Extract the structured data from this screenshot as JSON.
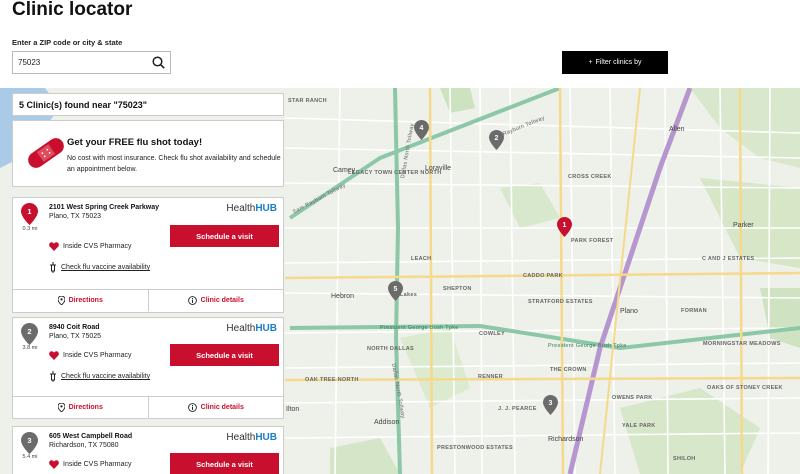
{
  "page": {
    "title": "Clinic locator"
  },
  "search": {
    "label": "Enter a ZIP code or city & state",
    "value": "75023",
    "placeholder": ""
  },
  "filter": {
    "label": "Filter clinics by"
  },
  "results": {
    "header": "5 Clinic(s) found near \"75023\""
  },
  "promo": {
    "title": "Get your FREE flu shot today!",
    "text": "No cost with most insurance. Check flu shot availability and schedule an appointment below."
  },
  "clinics": [
    {
      "number": "1",
      "distance": "0.3 mi",
      "street": "2101 West Spring Creek Parkway",
      "city": "Plano, TX 75023",
      "brand_a": "Health",
      "brand_b": "HUB",
      "schedule": "Schedule a visit",
      "inside": "Inside CVS Pharmacy",
      "flu": "Check flu vaccine availability",
      "directions": "Directions",
      "details": "Clinic details"
    },
    {
      "number": "2",
      "distance": "3.8 mi",
      "street": "8940 Coit Road",
      "city": "Plano, TX 75025",
      "brand_a": "Health",
      "brand_b": "HUB",
      "schedule": "Schedule a visit",
      "inside": "Inside CVS Pharmacy",
      "flu": "Check flu vaccine availability",
      "directions": "Directions",
      "details": "Clinic details"
    },
    {
      "number": "3",
      "distance": "5.4 mi",
      "street": "605 West Campbell Road",
      "city": "Richardson, TX 75080",
      "brand_a": "Health",
      "brand_b": "HUB",
      "schedule": "Schedule a visit",
      "inside": "Inside CVS Pharmacy",
      "flu": "",
      "directions": "",
      "details": ""
    }
  ],
  "map": {
    "labels": [
      {
        "text": "STAR RANCH"
      },
      {
        "text": "Loraville"
      },
      {
        "text": "Sam Rayburn Tollway"
      },
      {
        "text": "Allen"
      },
      {
        "text": "Camey"
      },
      {
        "text": "LEGACY TOWN CENTER NORTH"
      },
      {
        "text": "CROSS CREEK"
      },
      {
        "text": "Sam Rayburn Tollway"
      },
      {
        "text": "Parker"
      },
      {
        "text": "PARK FOREST"
      },
      {
        "text": "LEACH"
      },
      {
        "text": "CADDO PARK"
      },
      {
        "text": "C AND J ESTATES"
      },
      {
        "text": "Hebron"
      },
      {
        "text": "SHEPTON"
      },
      {
        "text": "STRATFORD ESTATES"
      },
      {
        "text": "Plano"
      },
      {
        "text": "FORMAN"
      },
      {
        "text": "President George Bush Tpke"
      },
      {
        "text": "COWLEY"
      },
      {
        "text": "President George Bush Tpke"
      },
      {
        "text": "NORTH DALLAS"
      },
      {
        "text": "MORNINGSTAR MEADOWS"
      },
      {
        "text": "THE CROWN"
      },
      {
        "text": "OAK TREE NORTH"
      },
      {
        "text": "RENNER"
      },
      {
        "text": "OAKS OF STONEY CREEK"
      },
      {
        "text": "OWENS PARK"
      },
      {
        "text": "J. J. PEARCE"
      },
      {
        "text": "Addison"
      },
      {
        "text": "Richardson"
      },
      {
        "text": "YALE PARK"
      },
      {
        "text": "PRESTONWOOD ESTATES"
      },
      {
        "text": "SHILOH"
      },
      {
        "text": "Dallas North Tollway"
      },
      {
        "text": "Dallas North Tollway"
      },
      {
        "text": "Lakes"
      },
      {
        "text": "Ilton"
      }
    ],
    "pins": [
      {
        "number": "1",
        "color": "#c8102e"
      },
      {
        "number": "2",
        "color": "#6b6b6b"
      },
      {
        "number": "3",
        "color": "#6b6b6b"
      },
      {
        "number": "4",
        "color": "#6b6b6b"
      },
      {
        "number": "5",
        "color": "#6b6b6b"
      }
    ]
  },
  "colors": {
    "accent": "#c8102e",
    "brand_blue": "#1a7fc6",
    "pin_grey": "#6b6b6b"
  }
}
